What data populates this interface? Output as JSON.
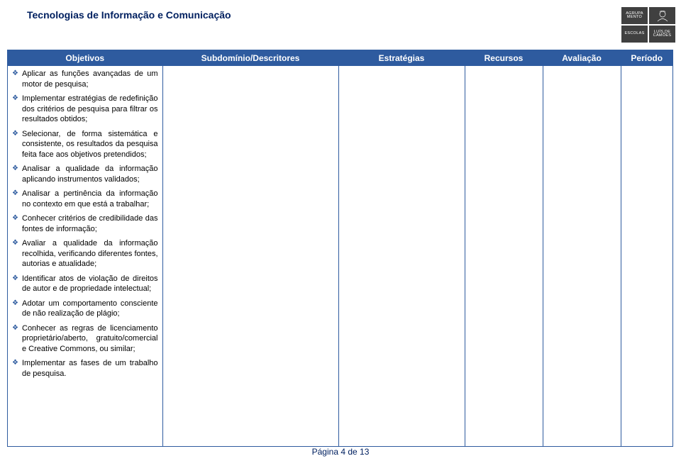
{
  "doc_title": "Tecnologias de Informação e Comunicação",
  "logo": {
    "q1_l1": "AGRUPA",
    "q1_l2": "MENTO",
    "q3": "ESCOLAS",
    "q4_l1": "LUÍS DE",
    "q4_l2": "CAMÕES"
  },
  "columns": {
    "c0": "Objetivos",
    "c1": "Subdomínio/Descritores",
    "c2": "Estratégias",
    "c3": "Recursos",
    "c4": "Avaliação",
    "c5": "Período"
  },
  "objectives": [
    "Aplicar as funções avançadas de um motor de pesquisa;",
    "Implementar estratégias de redefinição dos critérios de pesquisa para filtrar os resultados obtidos;",
    "Selecionar, de forma sistemática e consistente, os resultados da pesquisa feita face aos objetivos pretendidos;",
    "Analisar a qualidade da informação aplicando instrumentos validados;",
    "Analisar a pertinência da informação no contexto em que está a trabalhar;",
    "Conhecer critérios de credibilidade das fontes de informação;",
    "Avaliar a qualidade da informação recolhida, verificando diferentes fontes, autorias e atualidade;",
    "Identificar atos de violação de direitos de autor e de propriedade intelectual;",
    "Adotar um comportamento consciente de não realização de plágio;",
    "Conhecer as regras de licenciamento proprietário/aberto, gratuito/comercial e Creative Commons, ou similar;",
    "Implementar as fases de um trabalho de pesquisa."
  ],
  "footer": "Página 4 de 13"
}
